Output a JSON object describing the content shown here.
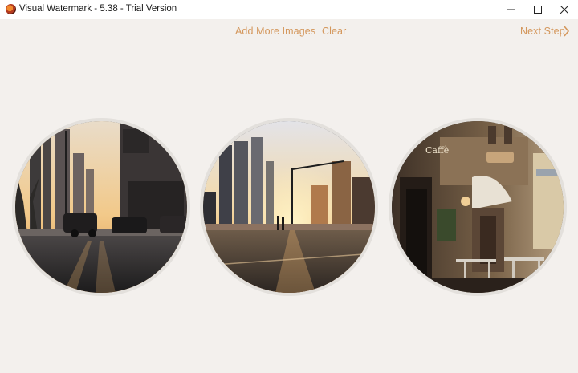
{
  "window": {
    "title": "Visual Watermark - 5.38 - Trial Version",
    "controls": [
      "minimize-icon",
      "maximize-icon",
      "close-icon"
    ]
  },
  "toolbar": {
    "add_more_label": "Add More Images",
    "clear_label": "Clear",
    "next_label": "Next Step",
    "accent_color": "#d4975c"
  },
  "images": [
    {
      "icon": "city-street-sunset-photo"
    },
    {
      "icon": "city-skyline-sunrise-photo"
    },
    {
      "icon": "restaurant-street-photo"
    }
  ],
  "colors": {
    "background": "#f3f0ed",
    "titlebar": "#ffffff"
  }
}
